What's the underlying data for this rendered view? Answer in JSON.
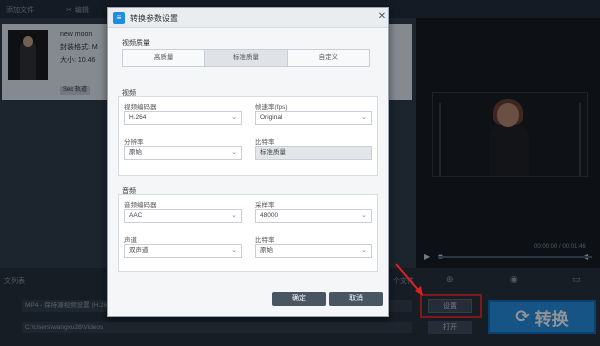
{
  "toolbar": {
    "add_file": "添加文件",
    "edit": "编辑"
  },
  "file": {
    "name": "new moon",
    "format_line": "封装格式: M",
    "size_line": "大小: 10.46",
    "subtitle": "Sec 轨道"
  },
  "player": {
    "time": "00:00:00 / 00:01:46"
  },
  "bottom": {
    "list_label": "文列表",
    "format_value": "MP4 - 保持源视频设置 (H.264)",
    "path_value": "C:\\Users\\wangxu28\\Videos",
    "settings_label": "设置",
    "open_label": "打开",
    "convert_label": "转换",
    "folder_label": "个文件"
  },
  "dialog": {
    "title": "转换参数设置",
    "quality": {
      "label": "视频质量",
      "options": [
        "高质量",
        "标准质量",
        "自定义"
      ],
      "selected": "标准质量"
    },
    "video": {
      "label": "视频",
      "encoder_label": "视频编码器",
      "encoder_value": "H.264",
      "fps_label": "帧速率(fps)",
      "fps_value": "Original",
      "resolution_label": "分辨率",
      "resolution_value": "原始",
      "bitrate_label": "比特率",
      "bitrate_value": "标准质量"
    },
    "audio": {
      "label": "音频",
      "encoder_label": "音频编码器",
      "encoder_value": "AAC",
      "samplerate_label": "采样率",
      "samplerate_value": "48000",
      "channel_label": "声道",
      "channel_value": "双声道",
      "bitrate_label": "比特率",
      "bitrate_value": "原始"
    },
    "ok_label": "确定",
    "cancel_label": "取消"
  },
  "colors": {
    "accent": "#1f8de0",
    "highlight": "#e02020",
    "dialog_bg": "#f4f6f8"
  }
}
